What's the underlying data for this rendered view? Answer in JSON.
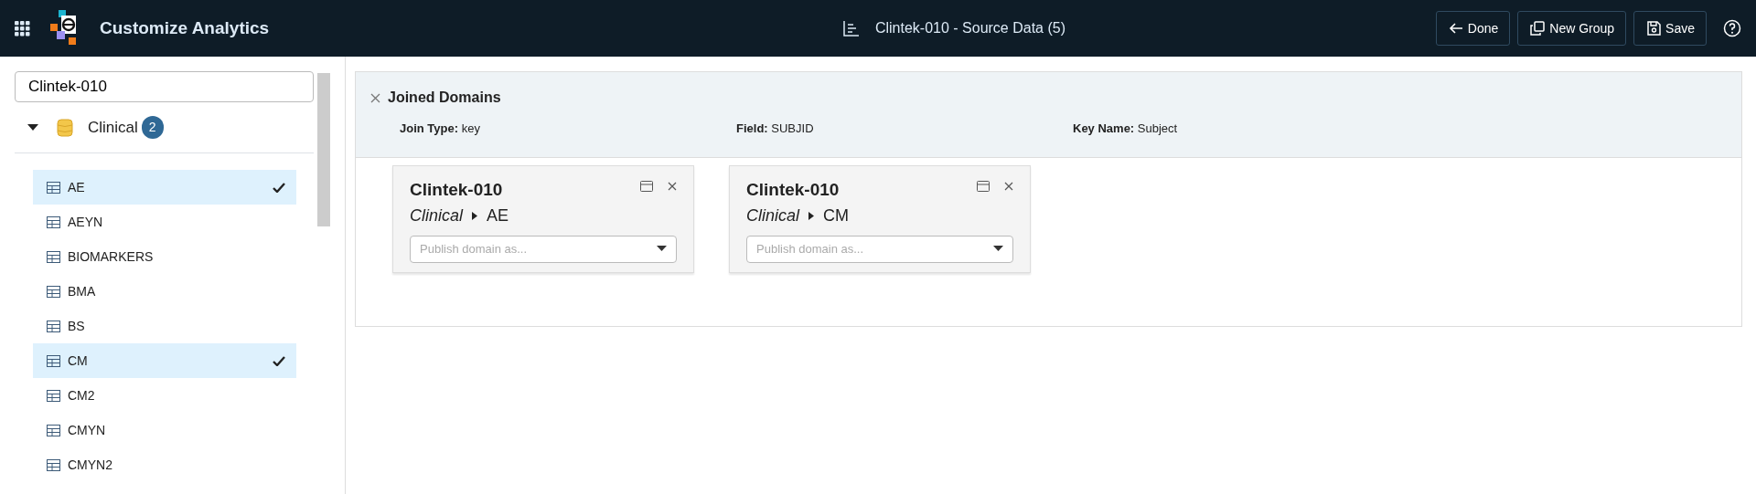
{
  "header": {
    "title": "Customize Analytics",
    "source": "Clintek-010 - Source Data (5)",
    "buttons": [
      {
        "kind": "done",
        "label": "Done"
      },
      {
        "kind": "group",
        "label": "New Group"
      },
      {
        "kind": "save",
        "label": "Save"
      }
    ]
  },
  "sidebar": {
    "search": {
      "value": "Clintek-010"
    },
    "group": {
      "label": "Clinical",
      "count": "2",
      "expanded": true
    },
    "items": [
      {
        "label": "AE",
        "selected": true
      },
      {
        "label": "AEYN",
        "selected": false
      },
      {
        "label": "BIOMARKERS",
        "selected": false
      },
      {
        "label": "BMA",
        "selected": false
      },
      {
        "label": "BS",
        "selected": false
      },
      {
        "label": "CM",
        "selected": true
      },
      {
        "label": "CM2",
        "selected": false
      },
      {
        "label": "CMYN",
        "selected": false
      },
      {
        "label": "CMYN2",
        "selected": false
      }
    ]
  },
  "join": {
    "title": "Joined Domains",
    "fields": [
      {
        "label": "Join Type:",
        "value": "key"
      },
      {
        "label": "Field:",
        "value": "SUBJID"
      },
      {
        "label": "Key Name:",
        "value": "Subject"
      }
    ],
    "cards": [
      {
        "title": "Clintek-010",
        "group": "Clinical",
        "domain": "AE",
        "placeholder": "Publish domain as..."
      },
      {
        "title": "Clintek-010",
        "group": "Clinical",
        "domain": "CM",
        "placeholder": "Publish domain as..."
      }
    ]
  }
}
